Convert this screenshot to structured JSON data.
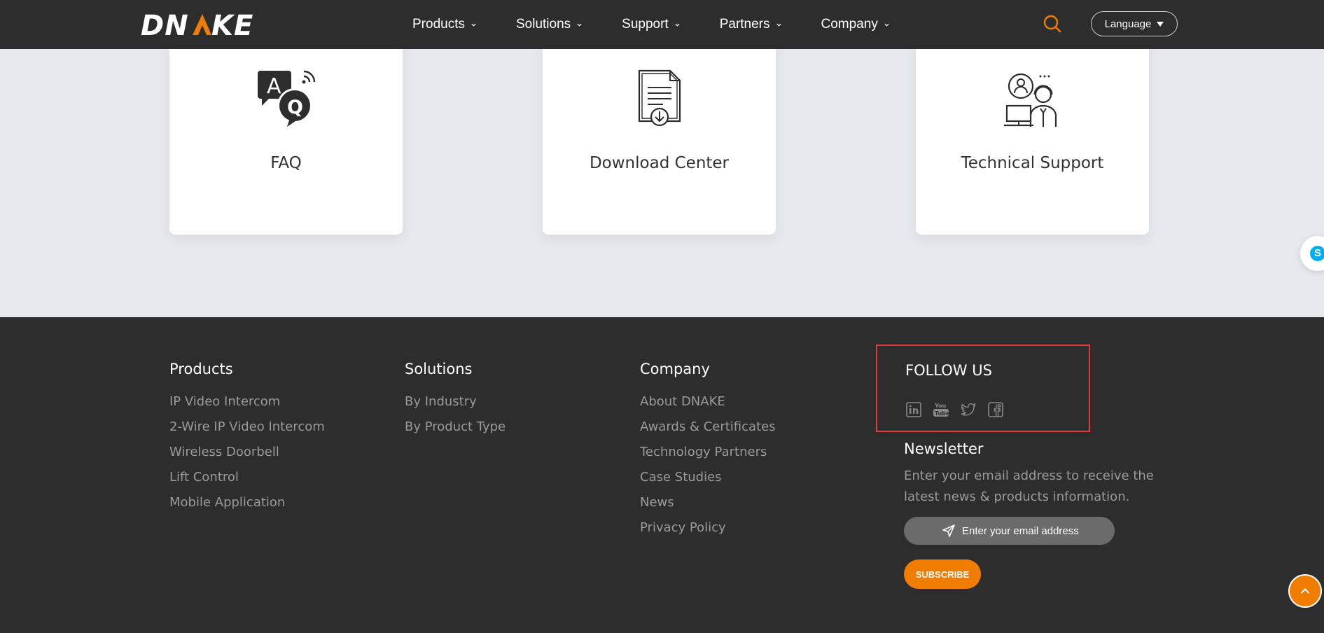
{
  "header": {
    "logo_text": "DNAKE",
    "nav": [
      {
        "label": "Products"
      },
      {
        "label": "Solutions"
      },
      {
        "label": "Support"
      },
      {
        "label": "Partners"
      },
      {
        "label": "Company"
      }
    ],
    "language_label": "Language",
    "search_icon": "search-icon"
  },
  "cards": [
    {
      "label": "FAQ",
      "icon": "faq-icon"
    },
    {
      "label": "Download Center",
      "icon": "download-document-icon"
    },
    {
      "label": "Technical Support",
      "icon": "technical-support-icon"
    }
  ],
  "footer": {
    "products": {
      "title": "Products",
      "links": [
        "IP Video Intercom",
        "2-Wire IP Video Intercom",
        "Wireless Doorbell",
        "Lift Control",
        "Mobile Application"
      ]
    },
    "solutions": {
      "title": "Solutions",
      "links": [
        "By Industry",
        "By Product Type"
      ]
    },
    "company": {
      "title": "Company",
      "links": [
        "About DNAKE",
        "Awards & Certificates",
        "Technology Partners",
        "Case Studies",
        "News",
        "Privacy Policy"
      ]
    },
    "follow": {
      "title": "FOLLOW US",
      "icons": [
        "linkedin-icon",
        "youtube-icon",
        "twitter-icon",
        "facebook-icon"
      ]
    },
    "newsletter": {
      "title": "Newsletter",
      "desc": "Enter your email address to receive the latest news & products information.",
      "placeholder": "Enter your email address",
      "subscribe_label": "SUBSCRIBE"
    }
  },
  "colors": {
    "accent": "#f07d00",
    "header_bg": "#2d2d2d",
    "page_bg": "#e5e8ed",
    "highlight_border": "#e03a3a"
  }
}
